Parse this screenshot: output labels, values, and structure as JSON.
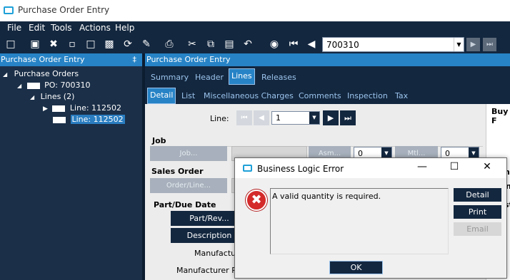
{
  "window": {
    "title": "Purchase Order Entry"
  },
  "menu": [
    "File",
    "Edit",
    "Tools",
    "Actions",
    "Help"
  ],
  "toolbar": {
    "po_number": "700310"
  },
  "tree": {
    "header": "Purchase Order Entry",
    "pin": "‡",
    "items": [
      {
        "label": "Purchase Orders"
      },
      {
        "label": "PO: 700310"
      },
      {
        "label": "Lines (2)"
      },
      {
        "label": "Line: 112502"
      },
      {
        "label": "Line: 112502"
      }
    ]
  },
  "panel": {
    "header": "Purchase Order Entry"
  },
  "tabs_main": [
    "Summary",
    "Header",
    "Lines",
    "Releases"
  ],
  "tabs_sub": [
    "Detail",
    "List",
    "Miscellaneous Charges",
    "Comments",
    "Inspection",
    "Tax"
  ],
  "form": {
    "line_label": "Line:",
    "line_value": "1",
    "job_section": "Job",
    "job_button": "Job...",
    "asm_button": "Asm...",
    "asm_value": "0",
    "mtl_button": "Mtl...",
    "mtl_value": "0",
    "sales_order_section": "Sales Order",
    "order_line_button": "Order/Line...",
    "part_due_section": "Part/Due Date",
    "part_rev_button": "Part/Rev...",
    "description_button": "Description",
    "manufacturer_label": "Manufactu",
    "manufacturer_part_label": "Manufacturer P",
    "buy_label": "Buy F",
    "right_frag_1": "nt",
    "right_frag_2": "n",
    "right_frag_3": "st"
  },
  "dialog": {
    "title": "Business Logic Error",
    "message": "A valid quantity is required.",
    "buttons": {
      "detail": "Detail",
      "print": "Print",
      "email": "Email",
      "ok": "OK"
    },
    "error_glyph": "✖"
  },
  "colors": {
    "navy": "#13273f",
    "accent": "#2783c6",
    "error": "#d42a2a"
  }
}
